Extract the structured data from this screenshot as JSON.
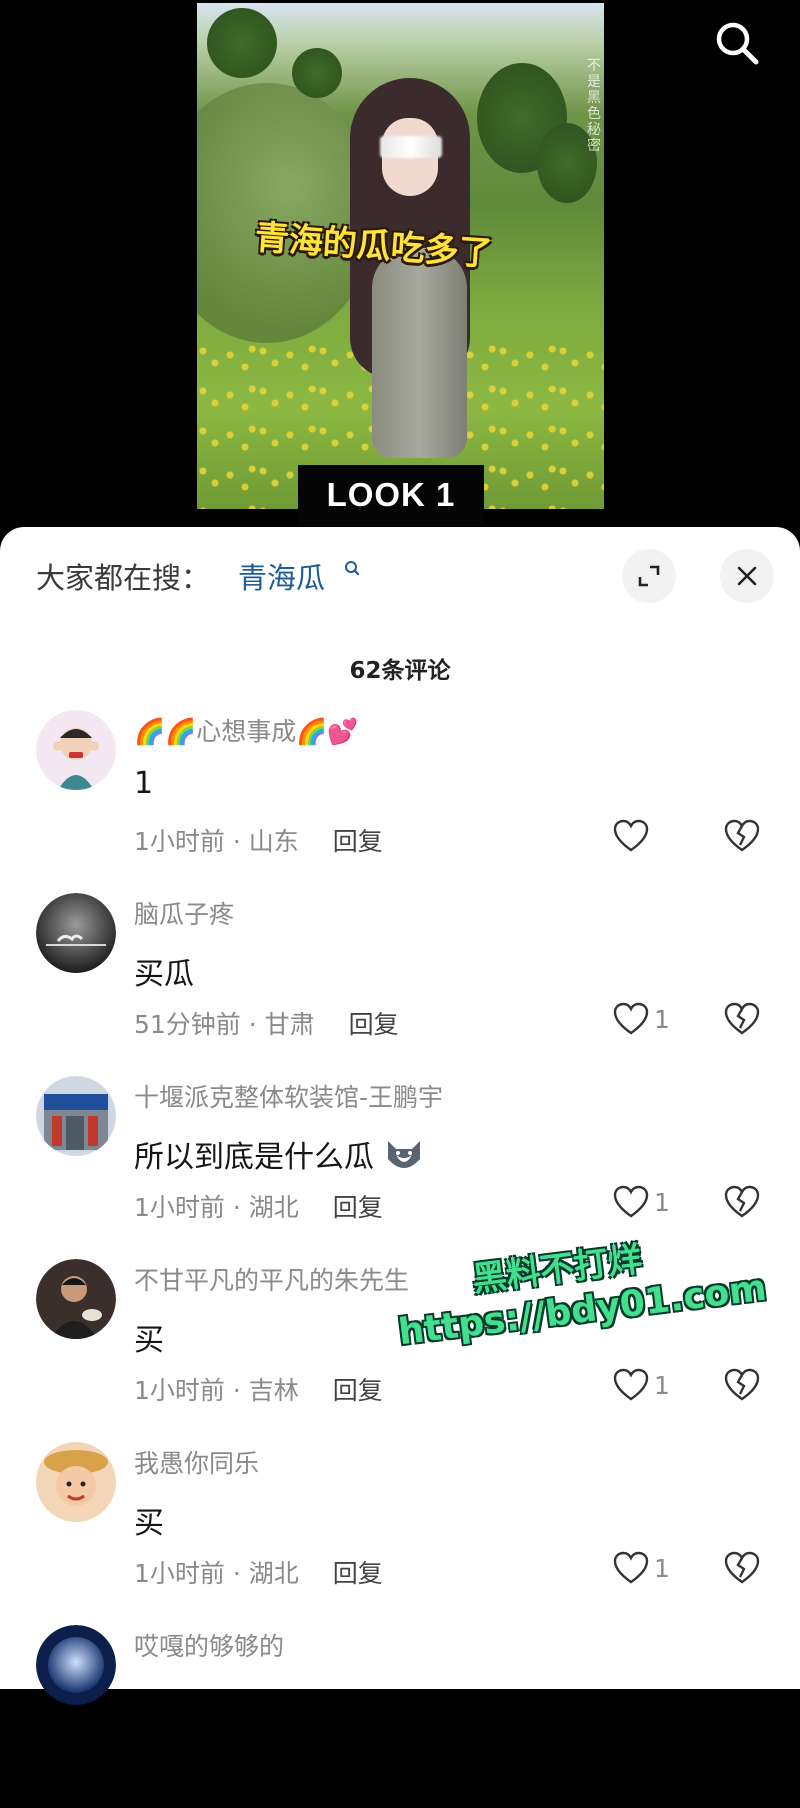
{
  "video": {
    "caption": "青海的瓜吃多了",
    "badge": "LOOK 1",
    "watermark": "不是黑色秘密"
  },
  "sheet": {
    "trending_label": "大家都在搜：",
    "trending_term": "青海瓜",
    "comment_count": "62条评论"
  },
  "comments": [
    {
      "user": "🌈🌈心想事成🌈💕",
      "text": "1",
      "time": "1小时前 · 山东",
      "reply": "回复",
      "likes": ""
    },
    {
      "user": "脑瓜子疼",
      "text": "买瓜",
      "time": "51分钟前 · 甘肃",
      "reply": "回复",
      "likes": "1"
    },
    {
      "user": "十堰派克整体软装馆-王鹏宇",
      "text": "所以到底是什么瓜",
      "time": "1小时前 · 湖北",
      "reply": "回复",
      "likes": "1"
    },
    {
      "user": "不甘平凡的平凡的朱先生",
      "text": "买",
      "time": "1小时前 · 吉林",
      "reply": "回复",
      "likes": "1"
    },
    {
      "user": "我愚你同乐",
      "text": "买",
      "time": "1小时前 · 湖北",
      "reply": "回复",
      "likes": "1"
    },
    {
      "user": "哎嘎的够够的",
      "text": "",
      "time": "",
      "reply": "",
      "likes": ""
    }
  ],
  "promo": {
    "line1": "黑料不打烊",
    "line2": "https://bdy01.com"
  },
  "icons": {
    "top_search": "search-icon",
    "expand": "expand-icon",
    "close": "close-icon",
    "like": "heart-outline-icon",
    "dislike": "broken-heart-icon"
  }
}
